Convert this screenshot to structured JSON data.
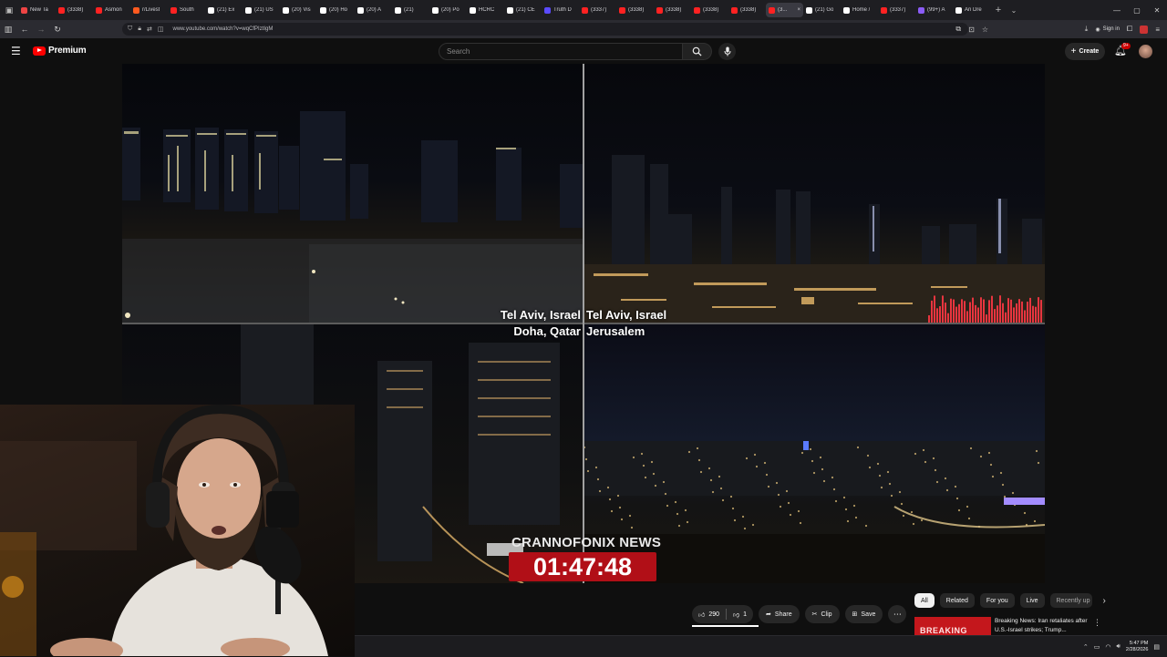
{
  "browser": {
    "tabs": [
      {
        "title": "New Ta",
        "color": "#e44"
      },
      {
        "title": "(3338) ",
        "color": "#f22"
      },
      {
        "title": "Asmon",
        "color": "#f22"
      },
      {
        "title": "r/Livest",
        "color": "#ff5a1f"
      },
      {
        "title": "South",
        "color": "#f22"
      },
      {
        "title": "(21) Ex",
        "color": "#fff"
      },
      {
        "title": "(21) US",
        "color": "#fff"
      },
      {
        "title": "(20) Vis",
        "color": "#fff"
      },
      {
        "title": "(20) Ho",
        "color": "#fff"
      },
      {
        "title": "(20) A",
        "color": "#fff"
      },
      {
        "title": "(21)",
        "color": "#fff"
      },
      {
        "title": "(20) Po",
        "color": "#fff"
      },
      {
        "title": "HCRC",
        "color": "#fff"
      },
      {
        "title": "(21) CE",
        "color": "#fff"
      },
      {
        "title": "Truth D",
        "color": "#5b4bff"
      },
      {
        "title": "(3337)",
        "color": "#f22"
      },
      {
        "title": "(3338)",
        "color": "#f22"
      },
      {
        "title": "(3338)",
        "color": "#f22"
      },
      {
        "title": "(3338)",
        "color": "#f22"
      },
      {
        "title": "(3338)",
        "color": "#f22"
      },
      {
        "title": "(3...",
        "color": "#f22",
        "active": true
      },
      {
        "title": "(21) Go",
        "color": "#fff"
      },
      {
        "title": "Home /",
        "color": "#fff"
      },
      {
        "title": "(3337)",
        "color": "#f22"
      },
      {
        "title": "(99+) A",
        "color": "#8b5cf6"
      },
      {
        "title": "Ari Dre",
        "color": "#fff"
      }
    ],
    "url": "www.youtube.com/watch?v=wqCfPIztIgM",
    "sign_in": "Sign in"
  },
  "youtube": {
    "logo_text": "Premium",
    "search_placeholder": "Search",
    "create_label": "Create",
    "notif_badge": "9+",
    "colors": {
      "brand_red": "#ff0000",
      "bg": "#0f0f0f",
      "pill": "#272727"
    }
  },
  "video": {
    "labels": {
      "top_left": "Tel Aviv, Israel",
      "top_right": "Tel Aviv, Israel",
      "bottom_left": "Doha, Qatar",
      "bottom_right": "Jerusalem"
    },
    "brand": "CRANNOFONIX NEWS",
    "timer": "01:47:48"
  },
  "actions": {
    "likes": "290",
    "dislikes": "1",
    "share": "Share",
    "clip": "Clip",
    "save": "Save"
  },
  "chips": [
    "All",
    "Related",
    "For you",
    "Live",
    "Recently up"
  ],
  "related_video": {
    "title": "Breaking News: Iran retaliates after U.S.-Israel strikes; Trump...",
    "thumb_text": "BREAKING"
  },
  "taskbar": {
    "time": "5:47 PM",
    "date": "2/28/2026"
  }
}
